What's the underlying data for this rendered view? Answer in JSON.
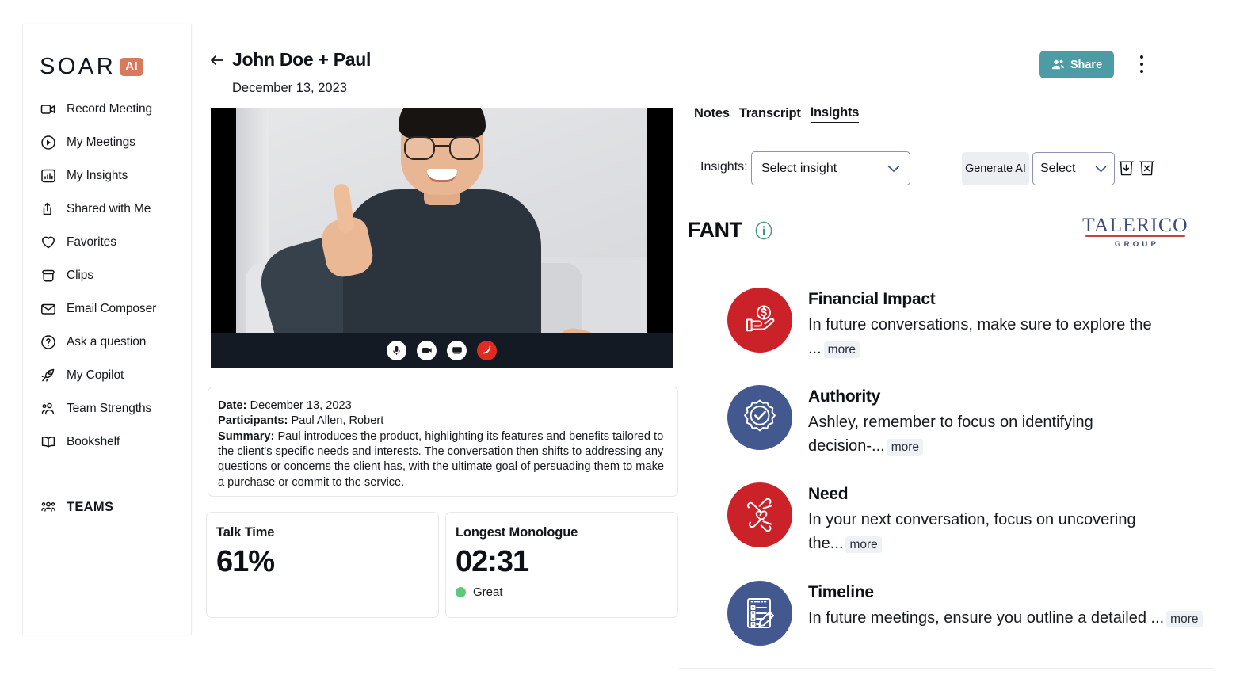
{
  "sidebar": {
    "logo": {
      "text": "SOAR",
      "badge": "AI"
    },
    "items": [
      {
        "label": "Record Meeting",
        "icon": "video-camera-icon"
      },
      {
        "label": "My Meetings",
        "icon": "play-circle-icon"
      },
      {
        "label": "My Insights",
        "icon": "bar-chart-icon"
      },
      {
        "label": "Shared with Me",
        "icon": "share-upload-icon"
      },
      {
        "label": "Favorites",
        "icon": "heart-icon"
      },
      {
        "label": "Clips",
        "icon": "clips-icon"
      },
      {
        "label": "Email Composer",
        "icon": "envelope-icon"
      },
      {
        "label": "Ask a question",
        "icon": "question-circle-icon"
      },
      {
        "label": "My Copilot",
        "icon": "rocket-icon"
      },
      {
        "label": "Team Strengths",
        "icon": "people-icon"
      },
      {
        "label": "Bookshelf",
        "icon": "book-icon"
      }
    ],
    "teams": {
      "label": "TEAMS",
      "icon": "group-people-icon"
    }
  },
  "header": {
    "back_icon": "arrow-left-icon",
    "title": "John Doe + Paul",
    "date": "December 13, 2023",
    "share_label": "Share",
    "share_icon": "people-add-icon",
    "share_color": "#4d9ba4",
    "menu_icon": "kebab-menu-icon"
  },
  "video": {
    "controls": [
      {
        "name": "microphone-icon",
        "state": "on"
      },
      {
        "name": "camera-icon",
        "state": "on"
      },
      {
        "name": "screen-share-icon",
        "state": "on"
      },
      {
        "name": "end-call-icon",
        "state": "end",
        "color": "#e02b20"
      }
    ]
  },
  "summary": {
    "date_label": "Date:",
    "date_value": "December 13, 2023",
    "participants_label": "Participants:",
    "participants_value": "Paul Allen, Robert",
    "summary_label": "Summary:",
    "summary_value": "Paul introduces the product, highlighting its features and benefits tailored to the client's specific needs and interests. The conversation then shifts to addressing any questions or concerns the client has, with the ultimate goal of persuading them to make a purchase or commit to the service."
  },
  "metrics": [
    {
      "label": "Talk Time",
      "value": "61%",
      "status": null
    },
    {
      "label": "Longest Monologue",
      "value": "02:31",
      "status": "Great",
      "status_color": "#5ec97e"
    }
  ],
  "right_panel": {
    "tabs": [
      {
        "label": "Notes",
        "active": false
      },
      {
        "label": "Transcript",
        "active": false
      },
      {
        "label": "Insights",
        "active": true
      }
    ],
    "insights_label": "Insights:",
    "insight_select_value": "Select insight",
    "generate_ai_label": "Generate AI",
    "select_value": "Select",
    "chevron_icon": "chevron-down-icon",
    "save_icon": "trash-download-icon",
    "delete_icon": "trash-x-icon",
    "framework_title": "FANT",
    "info_icon": "info-circle-icon",
    "info_color": "#4a9d7a",
    "brand": {
      "main": "TALERICO",
      "sub": "GROUP",
      "color": "#3b4a7d",
      "rule_color": "#c8413f"
    }
  },
  "fant_items": [
    {
      "title": "Financial Impact",
      "text": "In future conversations, make sure to explore the ...",
      "more": "more",
      "icon": "hand-dollar-icon",
      "color": "#cb2229"
    },
    {
      "title": "Authority",
      "text": "Ashley, remember to focus on identifying decision-...",
      "more": "more",
      "icon": "badge-check-icon",
      "color": "#43588e"
    },
    {
      "title": "Need",
      "text": "In your next conversation, focus on uncovering the...",
      "more": "more",
      "icon": "hands-heart-icon",
      "color": "#cb2229"
    },
    {
      "title": "Timeline",
      "text": "In future meetings, ensure you outline a detailed ...",
      "more": "more",
      "icon": "checklist-pencil-icon",
      "color": "#43588e"
    }
  ]
}
